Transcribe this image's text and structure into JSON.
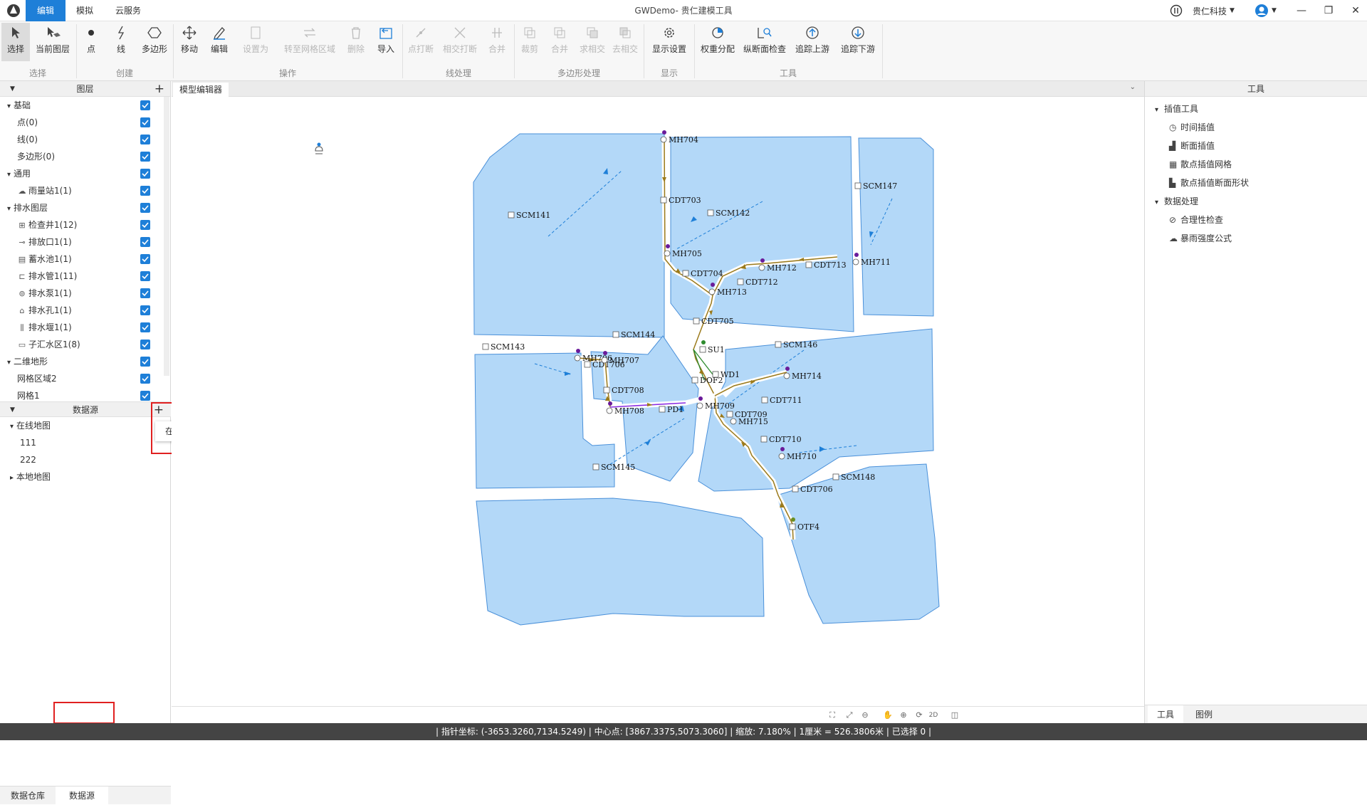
{
  "titlebar": {
    "app_title": "GWDemo- 贵仁建模工具",
    "menu_tabs": [
      "编辑",
      "模拟",
      "云服务"
    ],
    "company": "贵仁科技"
  },
  "ribbon": {
    "tools": [
      "选择",
      "当前图层",
      "点",
      "线",
      "多边形",
      "移动",
      "编辑",
      "设置为",
      "转至网格区域",
      "删除",
      "导入",
      "点打断",
      "相交打断",
      "合并",
      "裁剪",
      "合并",
      "求相交",
      "去相交",
      "显示设置",
      "权重分配",
      "纵断面检查",
      "追踪上游",
      "追踪下游"
    ],
    "groups": [
      "选择",
      "创建",
      "操作",
      "线处理",
      "多边形处理",
      "显示",
      "工具"
    ]
  },
  "left_panel": {
    "layers_title": "图层",
    "layers": [
      {
        "label": "基础",
        "level": 0,
        "icon": "collapse-icon"
      },
      {
        "label": "点(0)",
        "level": 1
      },
      {
        "label": "线(0)",
        "level": 1
      },
      {
        "label": "多边形(0)",
        "level": 1
      },
      {
        "label": "通用",
        "level": 0,
        "icon": "collapse-icon"
      },
      {
        "label": "雨量站1(1)",
        "level": 1,
        "icon": "rain-gauge-icon"
      },
      {
        "label": "排水图层",
        "level": 0,
        "icon": "collapse-icon"
      },
      {
        "label": "检查井1(12)",
        "level": 1,
        "icon": "manhole-icon"
      },
      {
        "label": "排放口1(1)",
        "level": 1,
        "icon": "outfall-icon"
      },
      {
        "label": "蓄水池1(1)",
        "level": 1,
        "icon": "storage-icon"
      },
      {
        "label": "排水管1(11)",
        "level": 1,
        "icon": "pipe-icon"
      },
      {
        "label": "排水泵1(1)",
        "level": 1,
        "icon": "pump-icon"
      },
      {
        "label": "排水孔1(1)",
        "level": 1,
        "icon": "orifice-icon"
      },
      {
        "label": "排水堰1(1)",
        "level": 1,
        "icon": "weir-icon"
      },
      {
        "label": "子汇水区1(8)",
        "level": 1,
        "icon": "catchment-icon"
      },
      {
        "label": "二维地形",
        "level": 0,
        "icon": "collapse-icon"
      },
      {
        "label": "网格区域2",
        "level": 1
      },
      {
        "label": "网格1",
        "level": 1
      }
    ],
    "datasource_title": "数据源",
    "datasource_tree": [
      {
        "label": "在线地图",
        "level": 0,
        "expanded": true
      },
      {
        "label": "111",
        "level": 1
      },
      {
        "label": "222",
        "level": 1
      },
      {
        "label": "本地地图",
        "level": 0,
        "expanded": false
      }
    ],
    "popup_item": "在线地图",
    "bottom_tabs": [
      "数据仓库",
      "数据源"
    ]
  },
  "editor": {
    "tab_label": "模型编辑器",
    "map_labels": [
      "MH704",
      "CDT703",
      "SCM141",
      "SCM142",
      "SCM147",
      "MH705",
      "CDT704",
      "MH712",
      "CDT713",
      "MH711",
      "CDT712",
      "MH713",
      "CDT705",
      "SCM144",
      "SCM143",
      "SCM146",
      "SU1",
      "MH706",
      "CDT706",
      "MH707",
      "WD1",
      "DOF2",
      "CDT708",
      "MH714",
      "CDT711",
      "MH708",
      "PD1",
      "MH709",
      "CDT709",
      "MH715",
      "CDT710",
      "MH710",
      "SCM145",
      "SCM148",
      "CDT706",
      "OTF4"
    ],
    "scale_label": "2D"
  },
  "right_panel": {
    "title": "工具",
    "sections": [
      {
        "label": "插值工具",
        "items": [
          "时间插值",
          "断面插值",
          "散点插值网格",
          "散点插值断面形状"
        ]
      },
      {
        "label": "数据处理",
        "items": [
          "合理性检查",
          "暴雨强度公式"
        ]
      }
    ],
    "bottom_tabs": [
      "工具",
      "图例"
    ]
  },
  "status": {
    "text": "| 指针坐标: (-3653.3260,7134.5249) | 中心点: [3867.3375,5073.3060] | 缩放: 7.180% | 1厘米 = 526.3806米 | 已选择 0 |"
  },
  "colors": {
    "accent": "#1e7fd8",
    "polygon": "#b3d8f8",
    "polygon_stroke": "#4a90d9",
    "pipe": "#9b7a1a",
    "highlight": "#e02020"
  }
}
